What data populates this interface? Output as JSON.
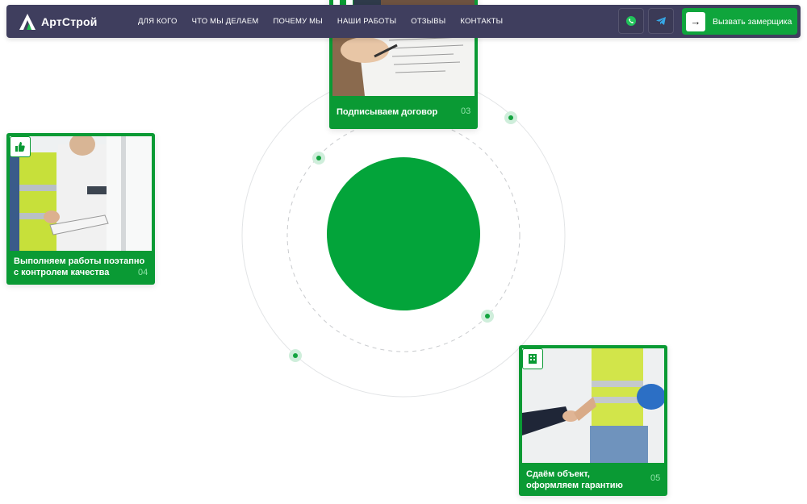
{
  "brand": {
    "name": "АртСтрой"
  },
  "nav": {
    "items": [
      {
        "label": "ДЛЯ КОГО"
      },
      {
        "label": "ЧТО МЫ ДЕЛАЕМ"
      },
      {
        "label": "ПОЧЕМУ МЫ"
      },
      {
        "label": "НАШИ РАБОТЫ"
      },
      {
        "label": "ОТЗЫВЫ"
      },
      {
        "label": "КОНТАКТЫ"
      }
    ]
  },
  "actions": {
    "whatsapp_icon": "whatsapp-icon",
    "telegram_icon": "telegram-icon",
    "cta_label": "Вызвать замерщика",
    "cta_arrow": "→"
  },
  "steps": [
    {
      "number": "03",
      "caption": "Подписываем договор",
      "badge_icon": "document-icon"
    },
    {
      "number": "04",
      "caption_line1": "Выполняем работы поэтапно",
      "caption_line2": "с контролем качества",
      "badge_icon": "thumbs-up-icon"
    },
    {
      "number": "05",
      "caption_line1": "Сдаём объект,",
      "caption_line2": "оформляем гарантию",
      "badge_icon": "building-icon"
    }
  ],
  "colors": {
    "header_bg": "#3f3e5e",
    "brand_green": "#0fa53c",
    "card_green": "#0a9a34",
    "circle_green": "#03a43a",
    "white": "#ffffff"
  }
}
